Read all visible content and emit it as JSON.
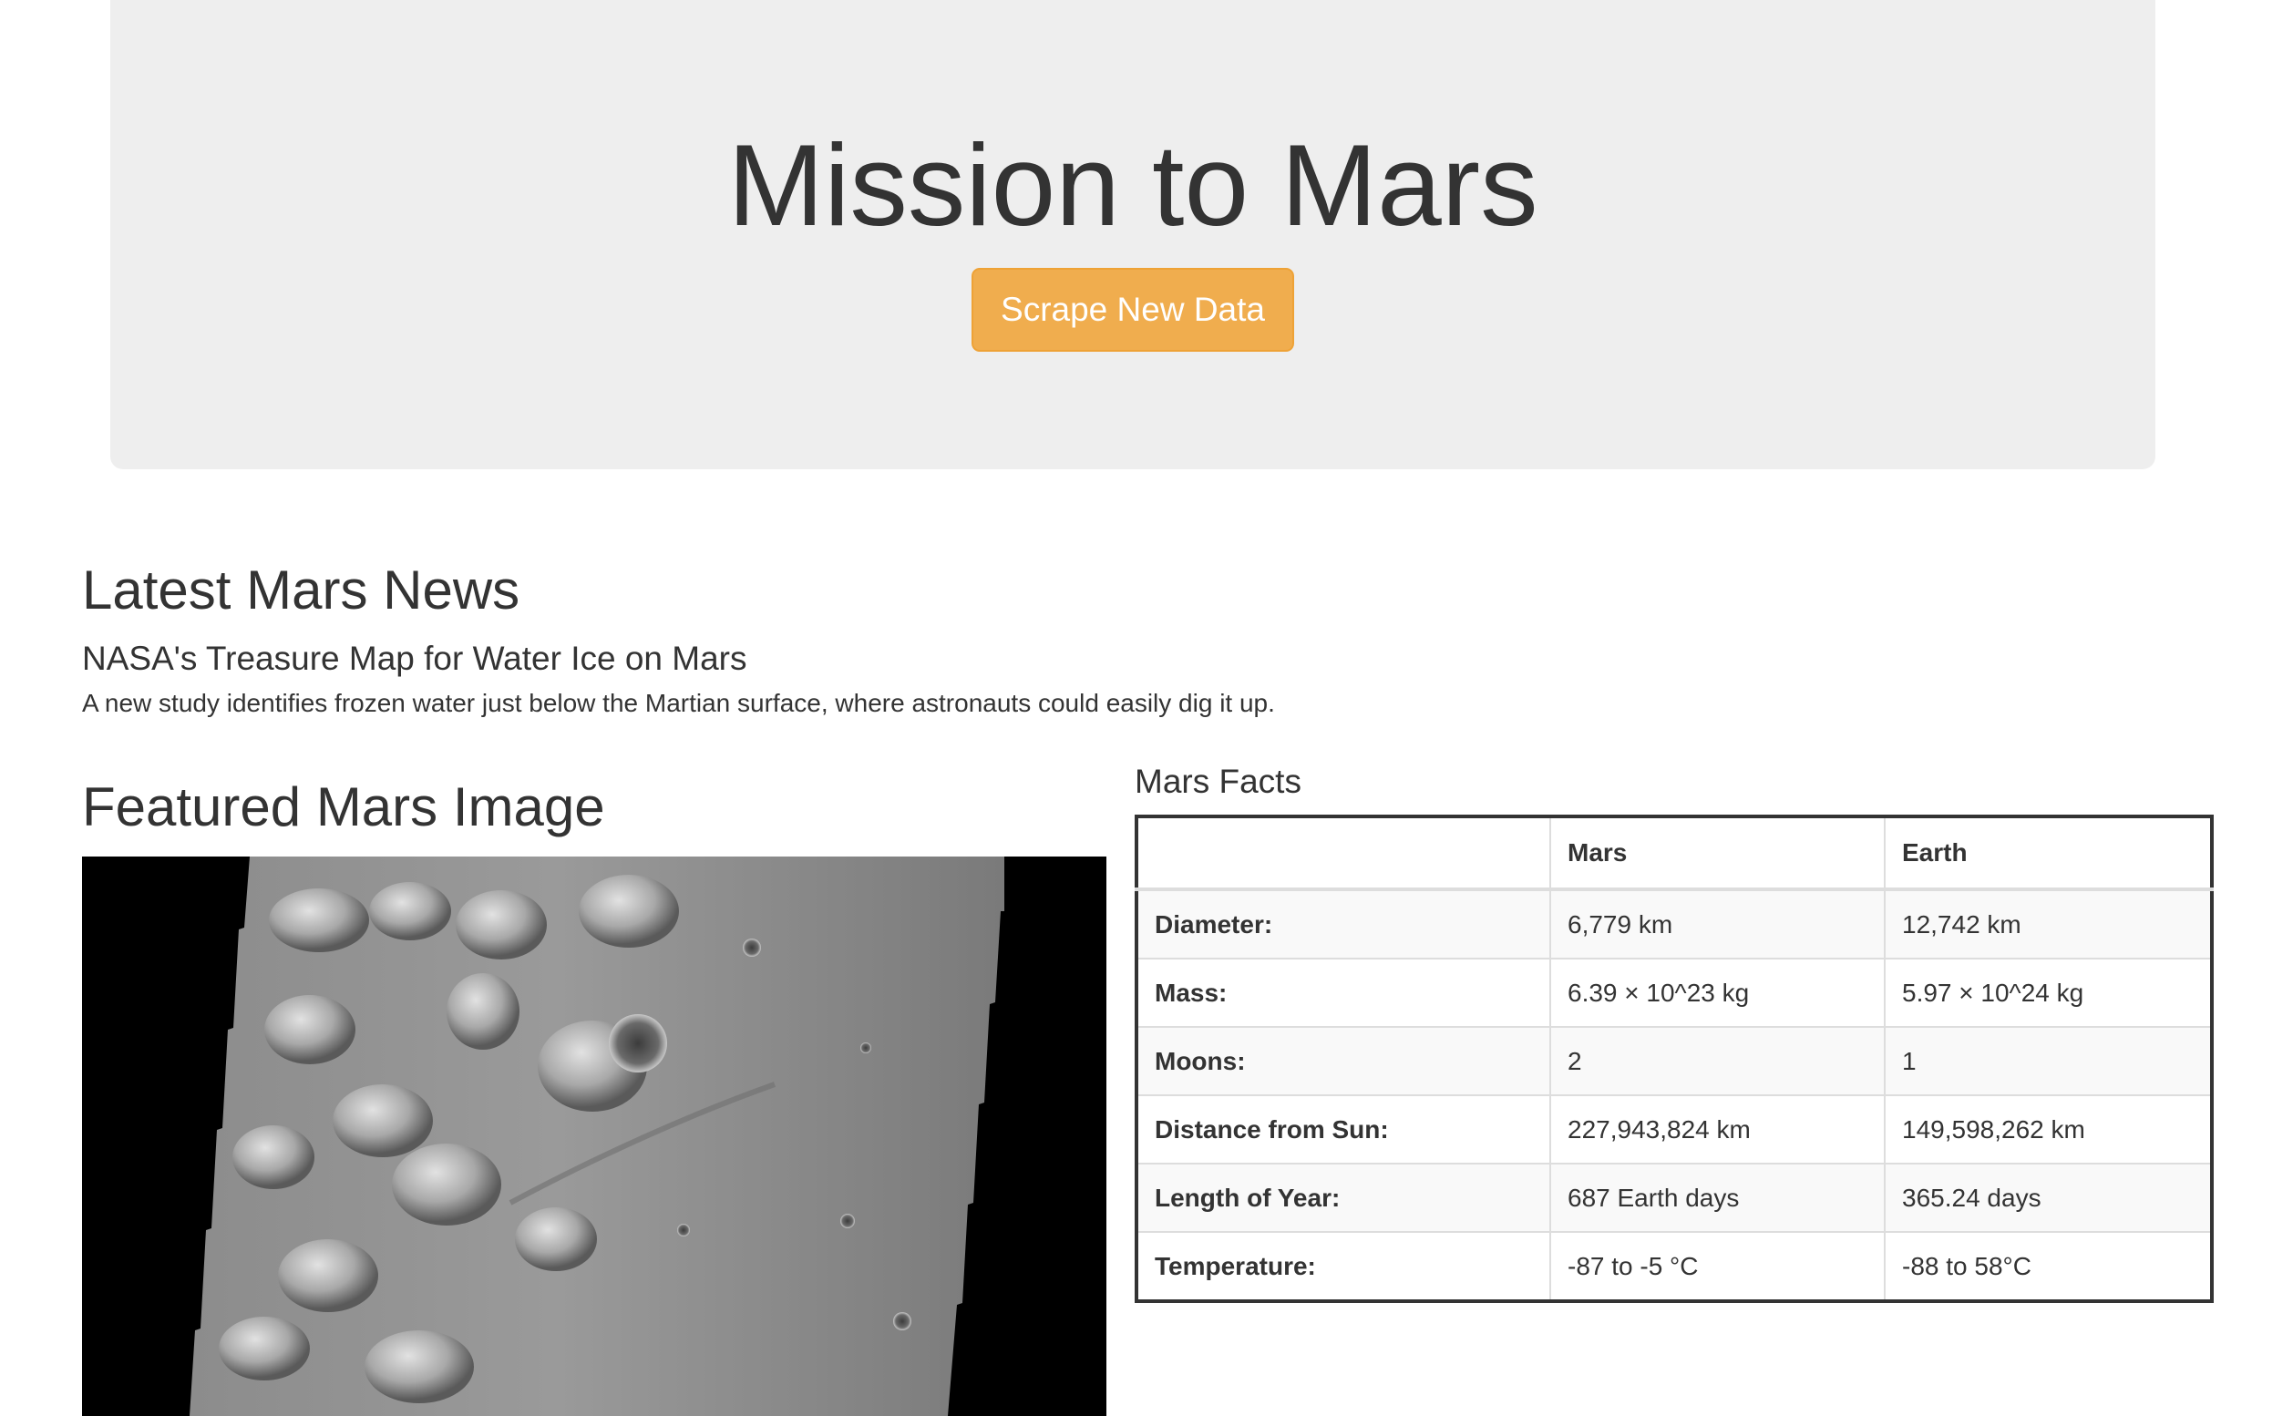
{
  "header": {
    "title": "Mission to Mars",
    "scrape_button_label": "Scrape New Data",
    "button_color": "#f0ad4e"
  },
  "news": {
    "heading": "Latest Mars News",
    "title": "NASA's Treasure Map for Water Ice on Mars",
    "teaser": "A new study identifies frozen water just below the Martian surface, where astronauts could easily dig it up."
  },
  "featured": {
    "heading": "Featured Mars Image"
  },
  "facts": {
    "heading": "Mars Facts",
    "columns": [
      "",
      "Mars",
      "Earth"
    ],
    "rows": [
      {
        "label": "Diameter:",
        "mars": "6,779 km",
        "earth": "12,742 km"
      },
      {
        "label": "Mass:",
        "mars": "6.39 × 10^23 kg",
        "earth": "5.97 × 10^24 kg"
      },
      {
        "label": "Moons:",
        "mars": "2",
        "earth": "1"
      },
      {
        "label": "Distance from Sun:",
        "mars": "227,943,824 km",
        "earth": "149,598,262 km"
      },
      {
        "label": "Length of Year:",
        "mars": "687 Earth days",
        "earth": "365.24 days"
      },
      {
        "label": "Temperature:",
        "mars": "-87 to -5 °C",
        "earth": "-88 to 58°C"
      }
    ]
  }
}
